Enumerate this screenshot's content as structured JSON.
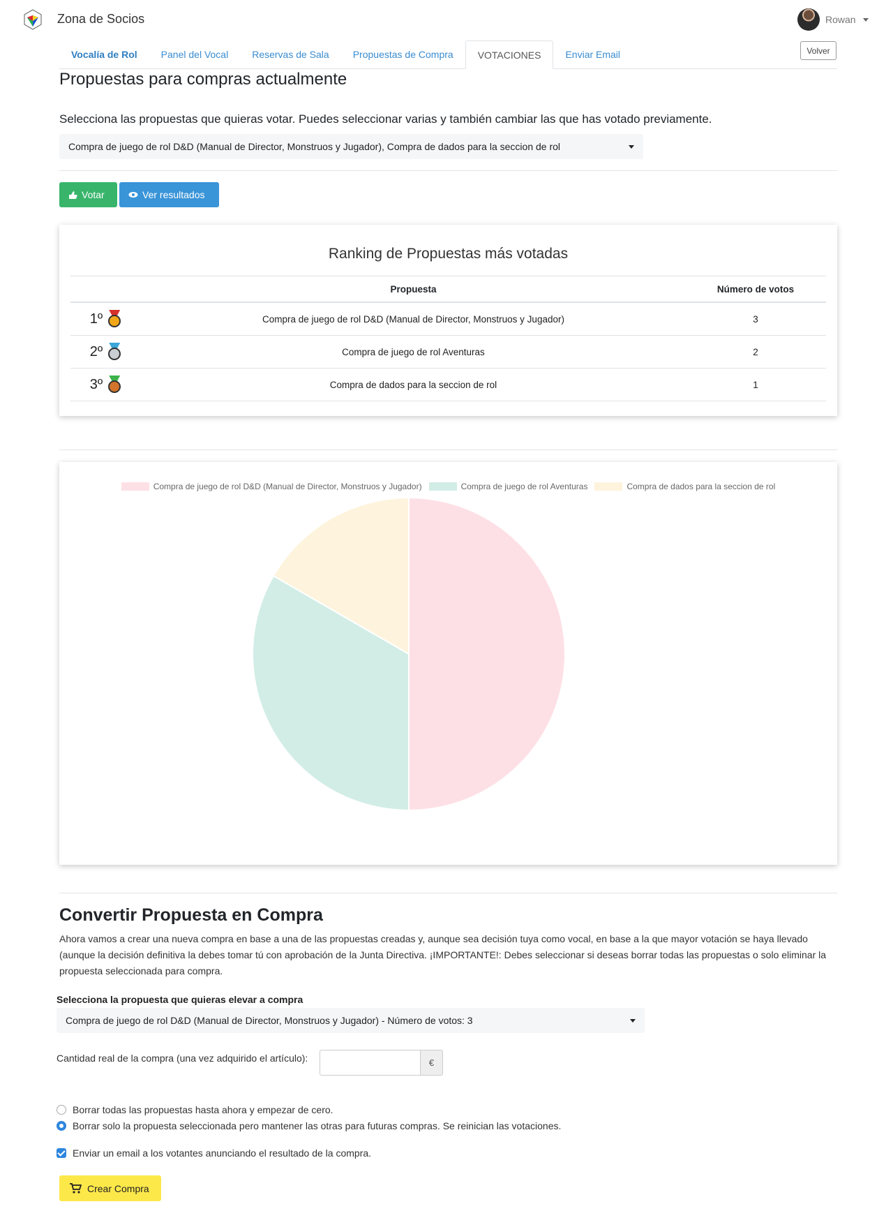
{
  "app": {
    "brand": "Zona de Socios"
  },
  "user": {
    "name": "Rowan"
  },
  "tabs": [
    {
      "label": "Vocalía de Rol"
    },
    {
      "label": "Panel del Vocal"
    },
    {
      "label": "Reservas de Sala"
    },
    {
      "label": "Propuestas de Compra"
    },
    {
      "label": "VOTACIONES"
    },
    {
      "label": "Enviar Email"
    }
  ],
  "volver_label": "Volver",
  "proposals": {
    "title": "Propuestas para compras actualmente",
    "instruction": "Selecciona las propuestas que quieras votar. Puedes seleccionar varias y también cambiar las que has votado previamente.",
    "selected": "Compra de juego de rol D&D (Manual de Director, Monstruos y Jugador), Compra de dados para la seccion de rol",
    "vote_label": "Votar",
    "results_label": "Ver resultados"
  },
  "ranking": {
    "title": "Ranking de Propuestas más votadas",
    "col_proposal": "Propuesta",
    "col_votes": "Número de votos",
    "rows": [
      {
        "pos": "1º",
        "proposal": "Compra de juego de rol D&D (Manual de Director, Monstruos y Jugador)",
        "votes": "3"
      },
      {
        "pos": "2º",
        "proposal": "Compra de juego de rol Aventuras",
        "votes": "2"
      },
      {
        "pos": "3º",
        "proposal": "Compra de dados para la seccion de rol",
        "votes": "1"
      }
    ]
  },
  "chart_data": {
    "type": "pie",
    "categories": [
      "Compra de juego de rol D&D (Manual de Director, Monstruos y Jugador)",
      "Compra de juego de rol Aventuras",
      "Compra de dados para la seccion de rol"
    ],
    "values": [
      3,
      2,
      1
    ],
    "colors": [
      "#fde0e5",
      "#d2ede6",
      "#fef3dc"
    ],
    "legend": "top"
  },
  "convert": {
    "title": "Convertir Propuesta en Compra",
    "paragraph": "Ahora vamos a crear una nueva compra en base a una de las propuestas creadas y, aunque sea decisión tuya como vocal, en base a la que mayor votación se haya llevado (aunque la decisión definitiva la debes tomar tú con aprobación de la Junta Directiva. ¡IMPORTANTE!: Debes seleccionar si deseas borrar todas las propuestas o solo eliminar la propuesta seleccionada para compra.",
    "select_label": "Selecciona la propuesta que quieras elevar a compra",
    "select_value": "Compra de juego de rol D&D (Manual de Director, Monstruos y Jugador) - Número de votos: 3",
    "amount_label": "Cantidad real de la compra (una vez adquirido el artículo):",
    "amount_value": "",
    "currency": "€",
    "radio_all": "Borrar todas las propuestas hasta ahora y empezar de cero.",
    "radio_selected": "Borrar solo la propuesta seleccionada pero mantener las otras para futuras compras. Se reinician las votaciones.",
    "email_check": "Enviar un email a los votantes anunciando el resultado de la compra.",
    "create_label": "Crear Compra"
  }
}
